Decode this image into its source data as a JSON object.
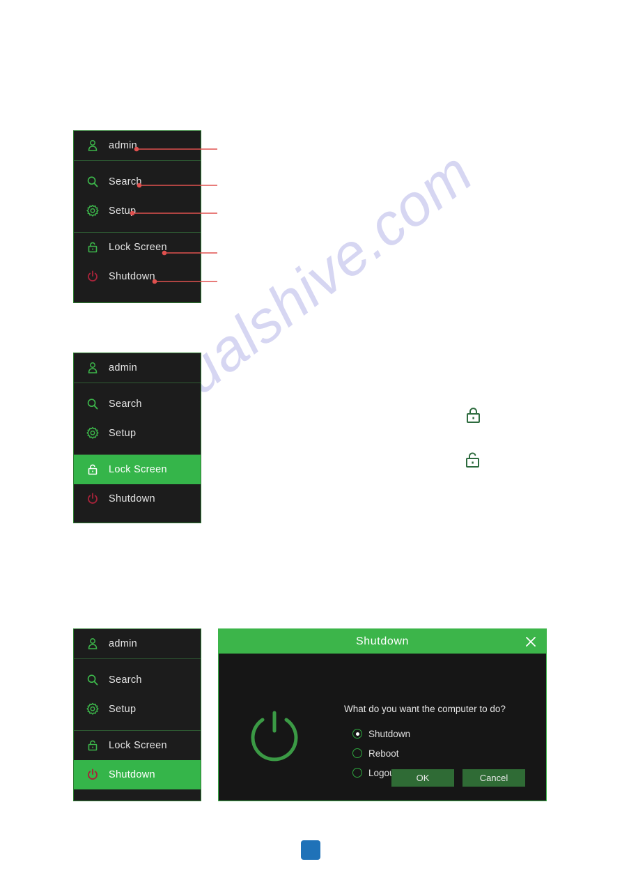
{
  "watermark": {
    "text": "manualshive.com"
  },
  "menus": {
    "annotated": {
      "items": [
        {
          "label": "admin",
          "icon": "user-icon"
        },
        {
          "label": "Search",
          "icon": "search-icon"
        },
        {
          "label": "Setup",
          "icon": "gear-icon"
        },
        {
          "label": "Lock Screen",
          "icon": "unlock-icon"
        },
        {
          "label": "Shutdown",
          "icon": "power-icon"
        }
      ]
    },
    "lock_selected": {
      "items": [
        {
          "label": "admin",
          "icon": "user-icon",
          "selected": false
        },
        {
          "label": "Search",
          "icon": "search-icon",
          "selected": false
        },
        {
          "label": "Setup",
          "icon": "gear-icon",
          "selected": false
        },
        {
          "label": "Lock Screen",
          "icon": "unlock-icon",
          "selected": true
        },
        {
          "label": "Shutdown",
          "icon": "power-icon",
          "selected": false
        }
      ]
    },
    "shutdown_selected": {
      "items": [
        {
          "label": "admin",
          "icon": "user-icon",
          "selected": false
        },
        {
          "label": "Search",
          "icon": "search-icon",
          "selected": false
        },
        {
          "label": "Setup",
          "icon": "gear-icon",
          "selected": false
        },
        {
          "label": "Lock Screen",
          "icon": "unlock-icon",
          "selected": false
        },
        {
          "label": "Shutdown",
          "icon": "power-icon",
          "selected": true
        }
      ]
    }
  },
  "lock_glyphs": [
    {
      "name": "locked-padlock-icon",
      "state": "locked"
    },
    {
      "name": "unlocked-padlock-icon",
      "state": "unlocked"
    }
  ],
  "dialog": {
    "title": "Shutdown",
    "close_label": "✕",
    "question": "What do you want the computer to do?",
    "options": [
      {
        "label": "Shutdown",
        "checked": true
      },
      {
        "label": "Reboot",
        "checked": false
      },
      {
        "label": "Logout",
        "checked": false
      }
    ],
    "ok_label": "OK",
    "cancel_label": "Cancel"
  },
  "colors": {
    "accent_green": "#3cb54a",
    "selected_green": "#35b54a",
    "panel_bg": "#1c1c1c",
    "dialog_bg": "#161616",
    "button_green": "#2f6b35",
    "power_red": "#a8233a",
    "leader_red": "#e0514f",
    "watermark": "#c9c9ee",
    "marker_blue": "#1f72b8"
  }
}
